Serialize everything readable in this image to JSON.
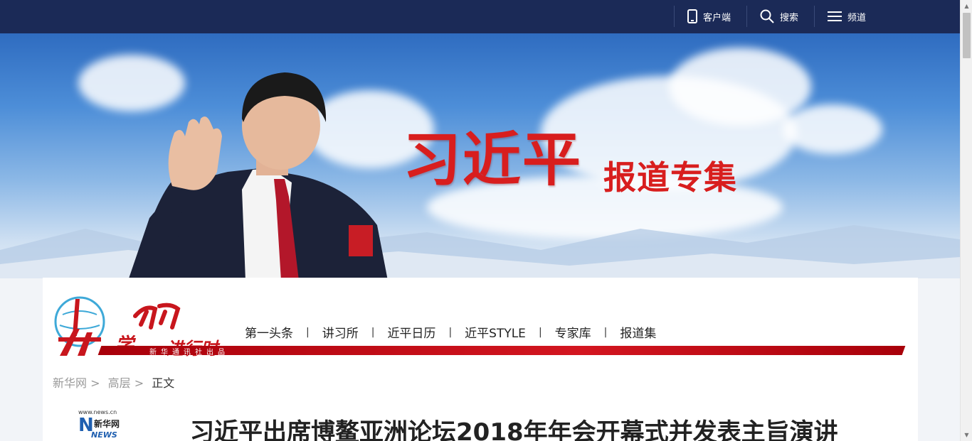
{
  "topbar": {
    "items": [
      {
        "label": "客户端",
        "icon": "mobile-icon"
      },
      {
        "label": "搜索",
        "icon": "search-icon"
      },
      {
        "label": "频道",
        "icon": "menu-icon"
      }
    ]
  },
  "banner": {
    "title": "习近平",
    "subtitle": "报道专集"
  },
  "logo": {
    "xue": "学",
    "xi_jinxing": "进行时",
    "tagline": "新华通讯社出品"
  },
  "channel_nav": [
    "第一头条",
    "讲习所",
    "近平日历",
    "近平STYLE",
    "专家库",
    "报道集"
  ],
  "breadcrumb": {
    "items": [
      "新华网",
      "高层"
    ],
    "separator": ">",
    "current": "正文"
  },
  "news_logo": {
    "url_text": "www.news.cn",
    "name": "新华网",
    "news": "NEWS"
  },
  "article": {
    "title": "习近平出席博鳌亚洲论坛2018年年会开幕式并发表主旨演讲"
  },
  "colors": {
    "topbar": "#1b2a57",
    "accent_red": "#d81e1e"
  }
}
